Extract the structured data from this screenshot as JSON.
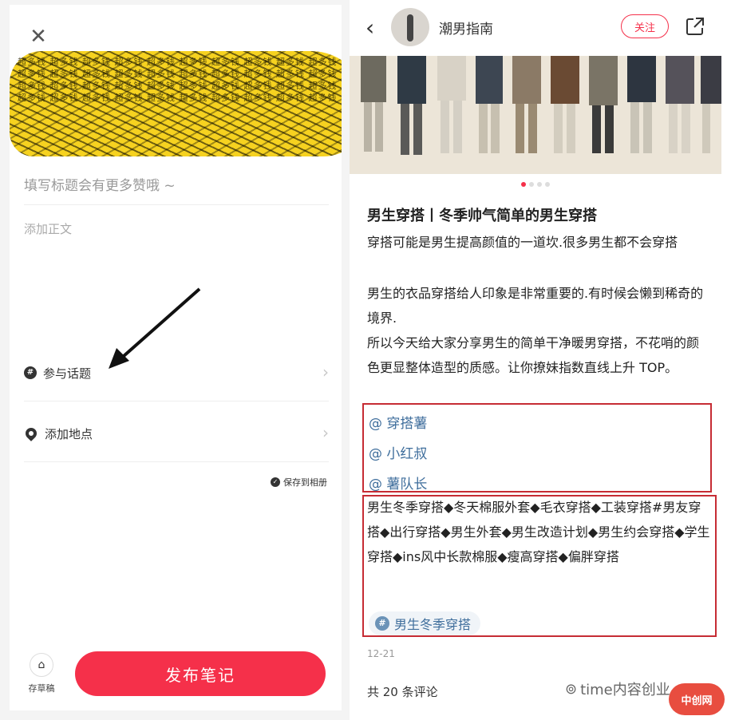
{
  "left": {
    "close_icon": "close-icon",
    "scribble_text": "超多钱 超多钱 超多钱 超多钱 超多钱 超多钱 超多钱 超多钱 超多钱 超多钱 超多钱 超多钱 超多钱 超多钱 超多钱 超多钱 超多钱 超多钱 超多钱 超多钱 超多钱 超多钱 超多钱 超多钱 超多钱 超多钱 超多钱 超多钱 超多钱 超多钱 超多钱 超多钱 超多钱 超多钱 超多钱 超多钱 超多钱 超多钱 超多钱 超多钱",
    "title_placeholder": "填写标题会有更多赞哦 ~",
    "body_placeholder": "添加正文",
    "topic_label": "参与话题",
    "location_label": "添加地点",
    "save_album_label": "保存到相册",
    "draft_label": "存草稿",
    "publish_label": "发布笔记"
  },
  "right": {
    "author": "潮男指南",
    "follow_label": "关注",
    "post_title": "男生穿搭丨冬季帅气简单的男生穿搭",
    "paragraphs": [
      "穿搭可能是男生提高颜值的一道坎.很多男生都不会穿搭",
      "男生的衣品穿搭给人印象是非常重要的.有时候会懒到稀奇的境界.",
      "所以今天给大家分享男生的简单干净暖男穿搭，不花哨的颜色更显整体造型的质感。让你撩妹指数直线上升  TOP。"
    ],
    "mentions": [
      "@ 穿搭薯",
      "@ 小红叔",
      "@ 薯队长"
    ],
    "tags": "男生冬季穿搭◆冬天棉服外套◆毛衣穿搭◆工装穿搭#男友穿搭◆出行穿搭◆男生外套◆男生改造计划◆男生约会穿搭◆学生穿搭◆ins风中长款棉服◆瘦高穿搭◆偏胖穿搭",
    "topic_chip": "男生冬季穿搭",
    "date": "12-21",
    "comments": "共 20 条评论",
    "watermark": "time内容创业",
    "watermark_logo": "中创网"
  },
  "colors": {
    "brand_red": "#f5304a",
    "link_blue": "#3f6e9c",
    "highlight_box": "#c62c34"
  }
}
